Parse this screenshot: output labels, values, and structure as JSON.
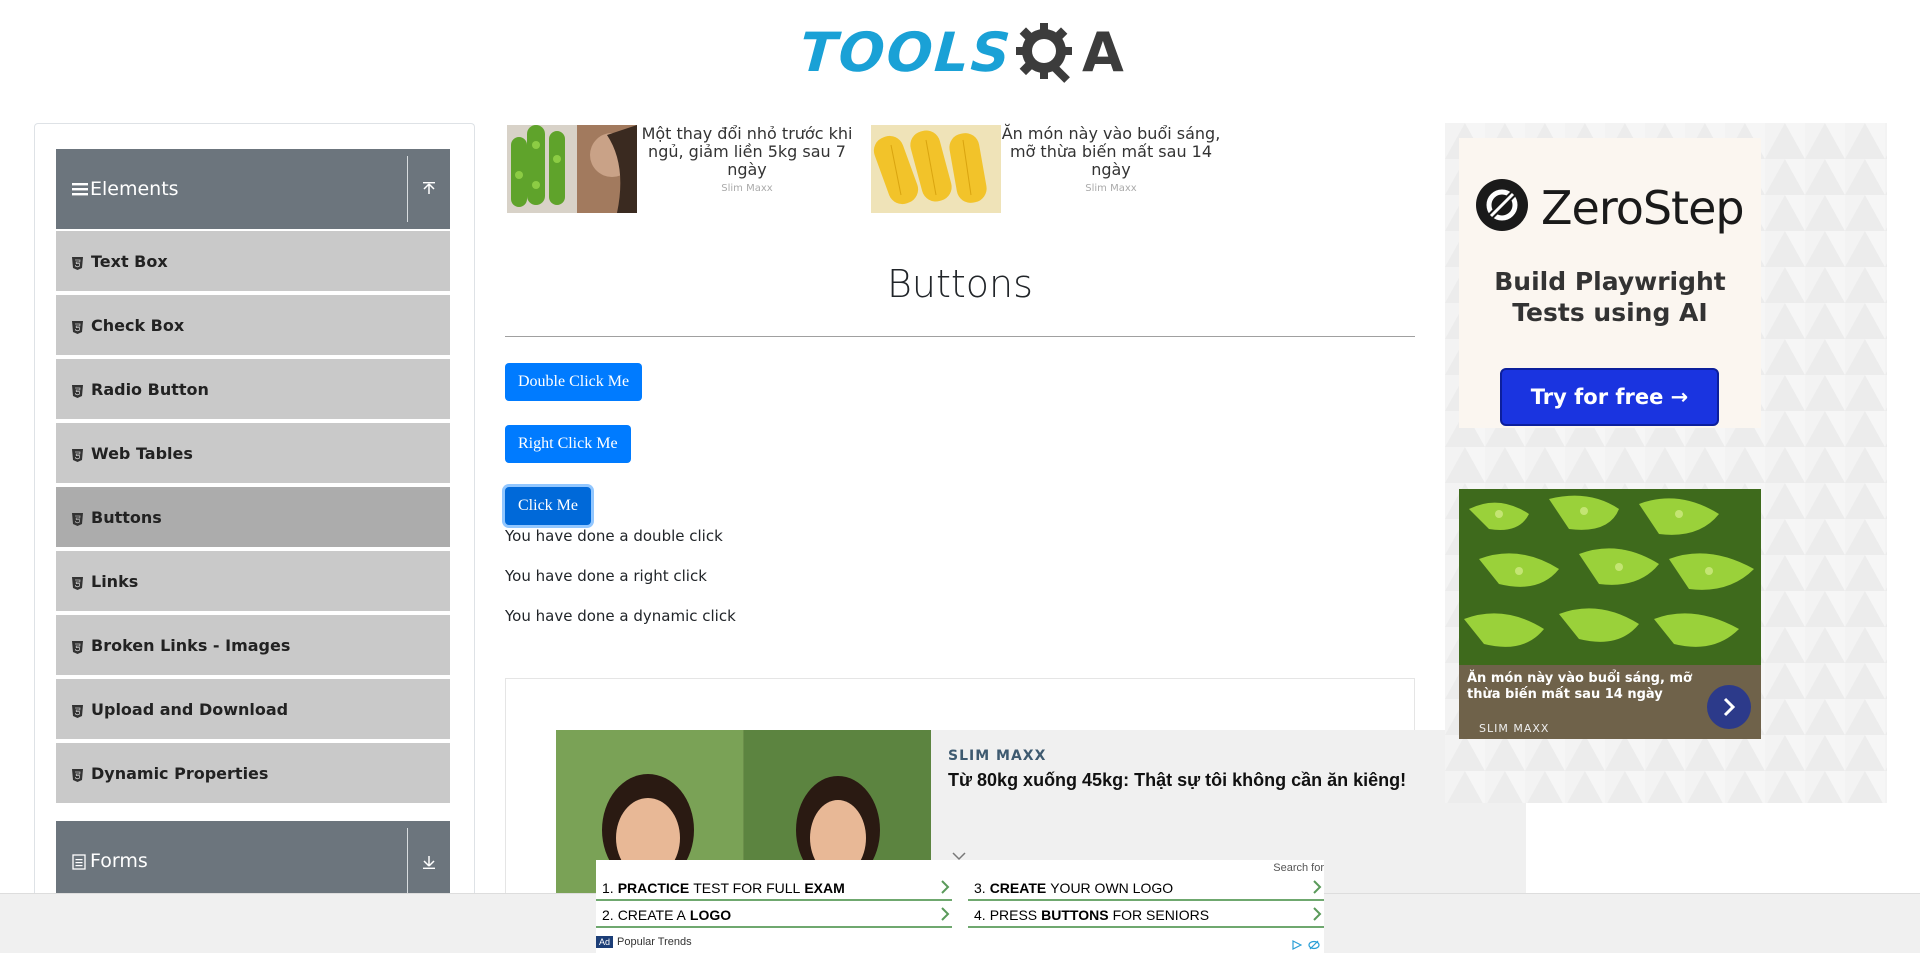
{
  "header": {
    "logo_tools": "TOOLS",
    "logo_qa": "A"
  },
  "sidebar": {
    "elements_group": "Elements",
    "items": [
      {
        "label": "Text Box"
      },
      {
        "label": "Check Box"
      },
      {
        "label": "Radio Button"
      },
      {
        "label": "Web Tables"
      },
      {
        "label": "Buttons",
        "active": true
      },
      {
        "label": "Links"
      },
      {
        "label": "Broken Links - Images"
      },
      {
        "label": "Upload and Download"
      },
      {
        "label": "Dynamic Properties"
      }
    ],
    "forms_group": "Forms"
  },
  "top_ads": [
    {
      "text": "Một thay đổi nhỏ trước khi ngủ, giảm liền 5kg sau 7 ngày",
      "source": "Slim Maxx"
    },
    {
      "text": "Ăn món này vào buổi sáng, mỡ thừa biến mất sau 14 ngày",
      "source": "Slim Maxx"
    }
  ],
  "main": {
    "title": "Buttons",
    "double_click_label": "Double Click Me",
    "right_click_label": "Right Click Me",
    "click_label": "Click Me",
    "messages": {
      "double": "You have done a double click",
      "right": "You have done a right click",
      "dynamic": "You have done a dynamic click"
    }
  },
  "slim_ad": {
    "brand": "SLIM MAXX",
    "title": "Từ 80kg xuống 45kg: Thật sự tôi không cần ăn kiêng!"
  },
  "right_ad": {
    "brand": "ZeroStep",
    "tagline": "Build Playwright Tests using AI",
    "cta": "Try for free →",
    "bitter_caption": "Ăn món này vào buổi sáng, mỡ thừa biến mất sau 14 ngày",
    "bitter_source": "SLIM MAXX"
  },
  "search_ad": {
    "search_for": "Search for",
    "items": [
      {
        "num": "1.",
        "bold1": "PRACTICE",
        "mid": "TEST FOR FULL",
        "bold2": "EXAM"
      },
      {
        "num": "2.",
        "bold1": "",
        "mid": "CREATE A",
        "bold2": "LOGO"
      },
      {
        "num": "3.",
        "bold1": "CREATE",
        "mid": "YOUR OWN LOGO",
        "bold2": ""
      },
      {
        "num": "4.",
        "bold1": "",
        "mid": "PRESS",
        "bold2": "BUTTONS",
        "tail": "FOR SENIORS"
      }
    ],
    "ad_label": "Ad",
    "popular": "Popular Trends"
  }
}
